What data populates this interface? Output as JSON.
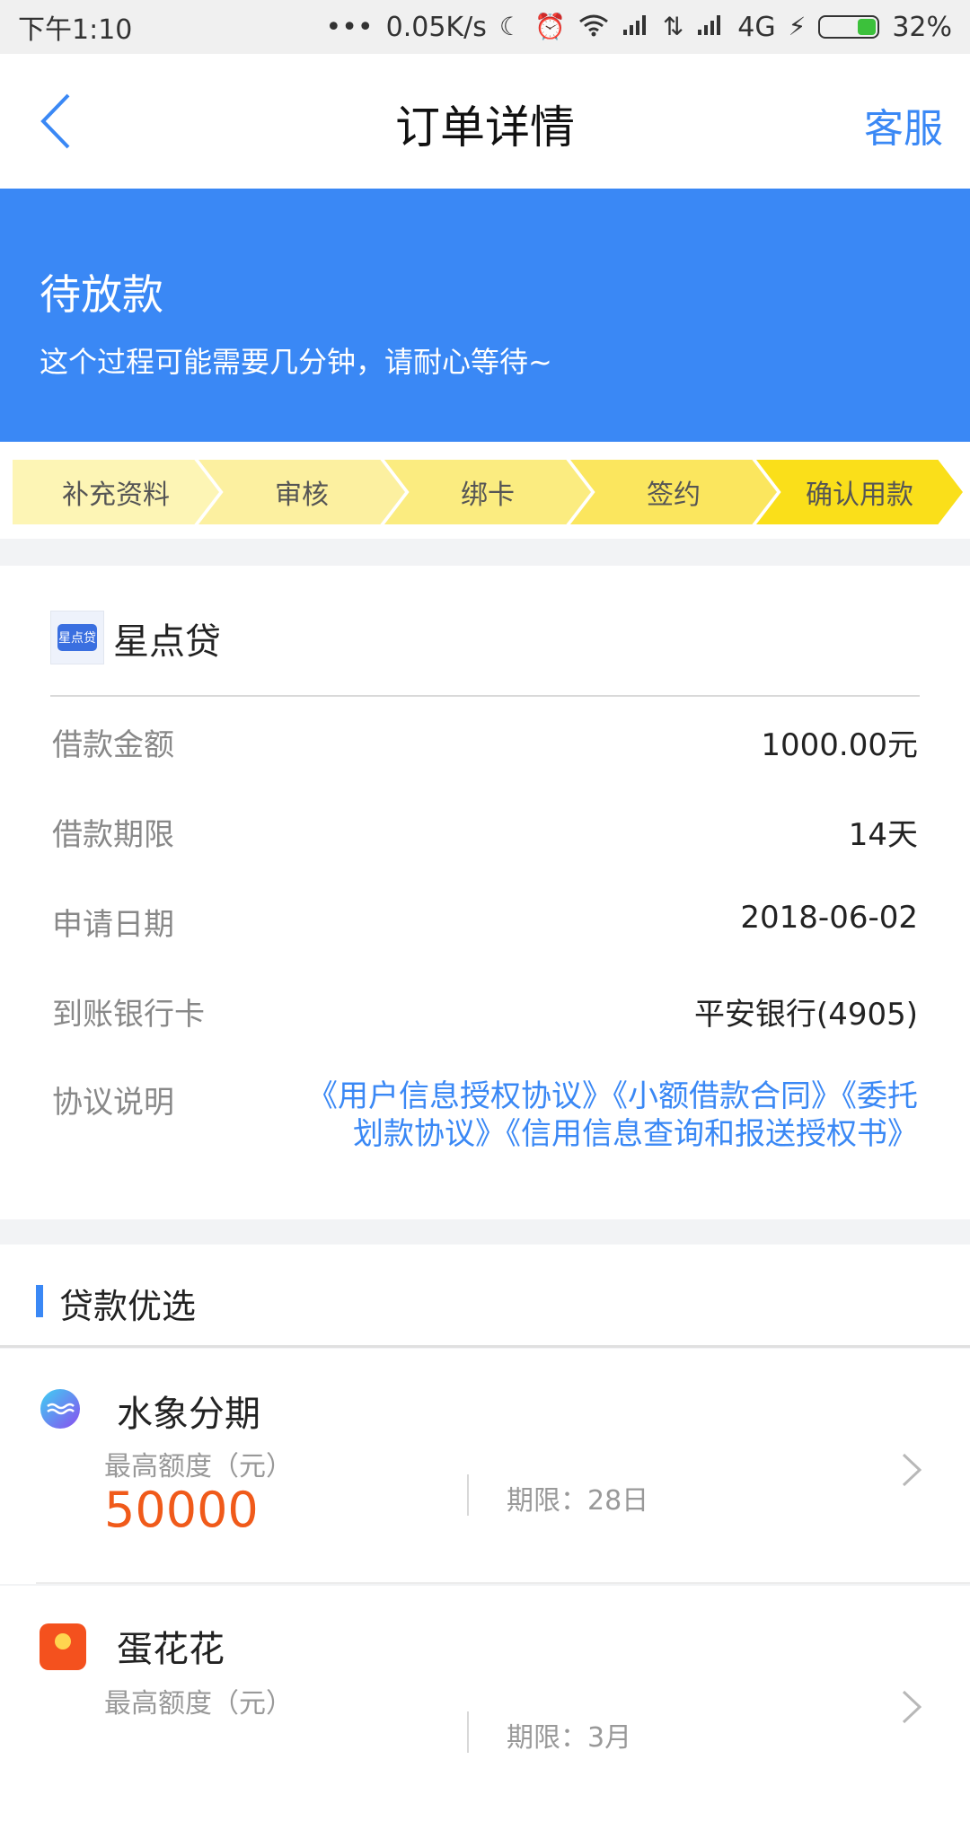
{
  "status_bar": {
    "time": "下午1:10",
    "dots": "•••",
    "speed": "0.05K/s",
    "network": "4G",
    "battery": "32%",
    "battery_level": 0.32
  },
  "nav": {
    "title": "订单详情",
    "service": "客服"
  },
  "banner": {
    "status": "待放款",
    "desc": "这个过程可能需要几分钟，请耐心等待~",
    "color": "#3a88f5"
  },
  "steps": [
    {
      "label": "补充资料",
      "color": "#fdf5b5"
    },
    {
      "label": "审核",
      "color": "#fcf0a0"
    },
    {
      "label": "绑卡",
      "color": "#fbec80"
    },
    {
      "label": "签约",
      "color": "#fbe65e"
    },
    {
      "label": "确认用款",
      "color": "#fadf1a"
    }
  ],
  "loan": {
    "product_name": "星点贷",
    "logo_text": "星点贷",
    "rows": [
      {
        "label": "借款金额",
        "value": "1000.00元"
      },
      {
        "label": "借款期限",
        "value": "14天"
      },
      {
        "label": "申请日期",
        "value": "2018-06-02"
      },
      {
        "label": "到账银行卡",
        "value": "平安银行(4905)"
      }
    ],
    "agreement_label": "协议说明",
    "agreements": "《用户信息授权协议》《小额借款合同》《委托划款协议》《信用信息查询和报送授权书》"
  },
  "recommend": {
    "title": "贷款优选",
    "offers": [
      {
        "name": "水象分期",
        "quota_label": "最高额度（元）",
        "amount": "50000",
        "term": "期限：28日",
        "icon": "water-wave-icon"
      },
      {
        "name": "蛋花花",
        "quota_label": "最高额度（元）",
        "amount": "",
        "term": "期限：3月",
        "icon": "danhuahua-logo-icon",
        "logo_text": "蛋花花"
      }
    ]
  },
  "colors": {
    "accent": "#3a88f5",
    "amount": "#f05a1a"
  }
}
